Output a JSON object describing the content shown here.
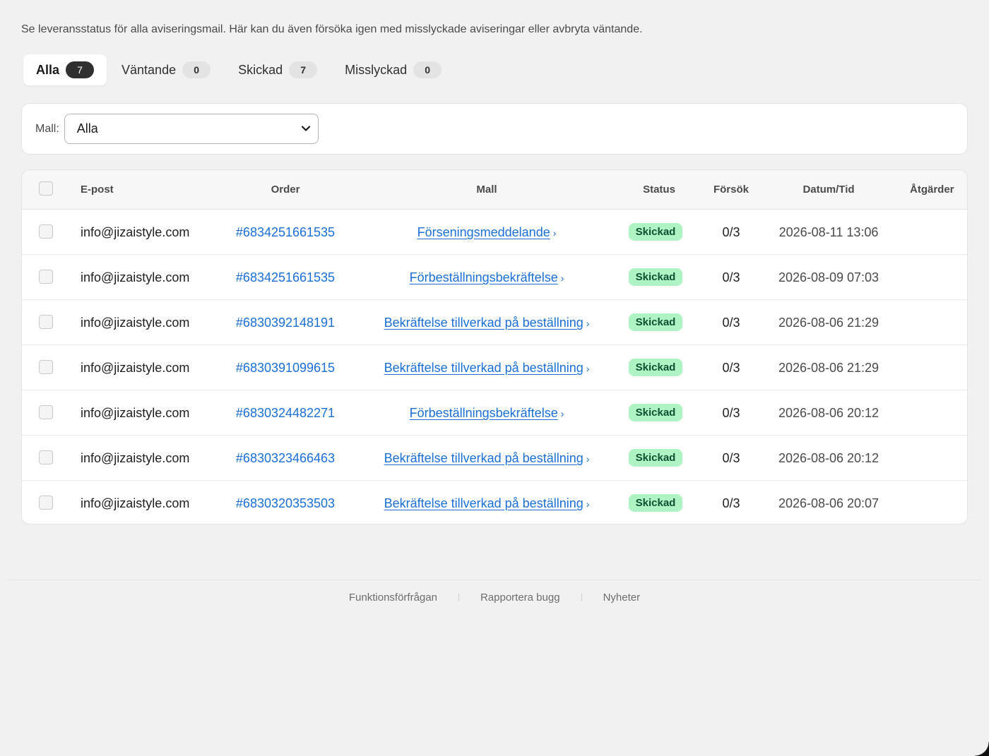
{
  "description": "Se leveransstatus för alla aviseringsmail. Här kan du även försöka igen med misslyckade aviseringar eller avbryta väntande.",
  "tabs": [
    {
      "label": "Alla",
      "count": "7",
      "active": true
    },
    {
      "label": "Väntande",
      "count": "0",
      "active": false
    },
    {
      "label": "Skickad",
      "count": "7",
      "active": false
    },
    {
      "label": "Misslyckad",
      "count": "0",
      "active": false
    }
  ],
  "filter": {
    "label": "Mall:",
    "selected": "Alla"
  },
  "table": {
    "headers": {
      "email": "E-post",
      "order": "Order",
      "mall": "Mall",
      "status": "Status",
      "forsok": "Försök",
      "date": "Datum/Tid",
      "actions": "Åtgärder"
    },
    "rows": [
      {
        "email": "info@jizaistyle.com",
        "order": "#6834251661535",
        "mall": "Förseningsmeddelande",
        "status": "Skickad",
        "attempts": "0/3",
        "date": "2026-08-11 13:06"
      },
      {
        "email": "info@jizaistyle.com",
        "order": "#6834251661535",
        "mall": "Förbeställningsbekräftelse",
        "status": "Skickad",
        "attempts": "0/3",
        "date": "2026-08-09 07:03"
      },
      {
        "email": "info@jizaistyle.com",
        "order": "#6830392148191",
        "mall": "Bekräftelse tillverkad på beställning",
        "status": "Skickad",
        "attempts": "0/3",
        "date": "2026-08-06 21:29"
      },
      {
        "email": "info@jizaistyle.com",
        "order": "#6830391099615",
        "mall": "Bekräftelse tillverkad på beställning",
        "status": "Skickad",
        "attempts": "0/3",
        "date": "2026-08-06 21:29"
      },
      {
        "email": "info@jizaistyle.com",
        "order": "#6830324482271",
        "mall": "Förbeställningsbekräftelse",
        "status": "Skickad",
        "attempts": "0/3",
        "date": "2026-08-06 20:12"
      },
      {
        "email": "info@jizaistyle.com",
        "order": "#6830323466463",
        "mall": "Bekräftelse tillverkad på beställning",
        "status": "Skickad",
        "attempts": "0/3",
        "date": "2026-08-06 20:12"
      },
      {
        "email": "info@jizaistyle.com",
        "order": "#6830320353503",
        "mall": "Bekräftelse tillverkad på beställning",
        "status": "Skickad",
        "attempts": "0/3",
        "date": "2026-08-06 20:07"
      }
    ]
  },
  "footer": {
    "links": [
      "Funktionsförfrågan",
      "Rapportera bugg",
      "Nyheter"
    ]
  },
  "icons": {
    "mall_link_arrow": "›",
    "select_chevron": "chevron-down-icon"
  },
  "colors": {
    "link": "#1a6fd6",
    "badge_bg": "#aff2c4",
    "badge_text": "#0c5132",
    "active_count_bg": "#303030"
  }
}
